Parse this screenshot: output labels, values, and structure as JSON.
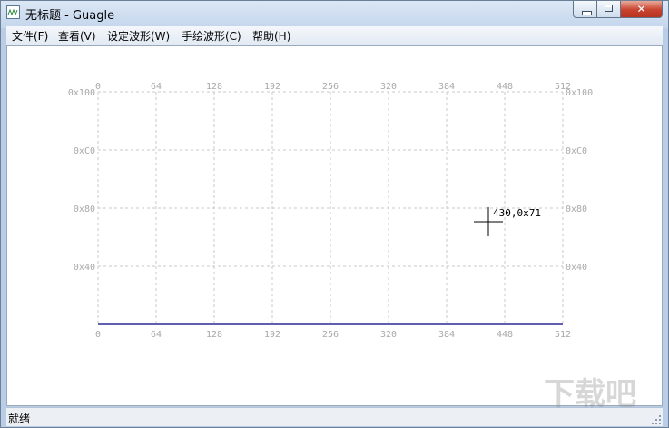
{
  "window": {
    "title": "无标题 - Guagle"
  },
  "controls": {
    "close_glyph": "✕"
  },
  "menu": {
    "items": [
      {
        "label": "文件(F)"
      },
      {
        "label": "查看(V)"
      },
      {
        "label": "设定波形(W)"
      },
      {
        "label": "手绘波形(C)"
      },
      {
        "label": "帮助(H)"
      }
    ]
  },
  "plot": {
    "x_ticks": [
      "0",
      "64",
      "128",
      "192",
      "256",
      "320",
      "384",
      "448",
      "512"
    ],
    "y_ticks_top_to_bottom": [
      "0x100",
      "0xC0",
      "0x80",
      "0x40"
    ],
    "x_range": [
      0,
      512
    ],
    "y_range": [
      0,
      256
    ],
    "grid": true,
    "waveform_value": 0,
    "cursor": {
      "x": 430,
      "y": 113,
      "label": "430,0x71"
    },
    "colors": {
      "grid": "#c8c8c8",
      "labels": "#a8a8a8",
      "waveform": "#000080",
      "cursor": "#000000"
    }
  },
  "status": {
    "text": "就绪"
  },
  "watermark": {
    "text": "下载吧"
  }
}
